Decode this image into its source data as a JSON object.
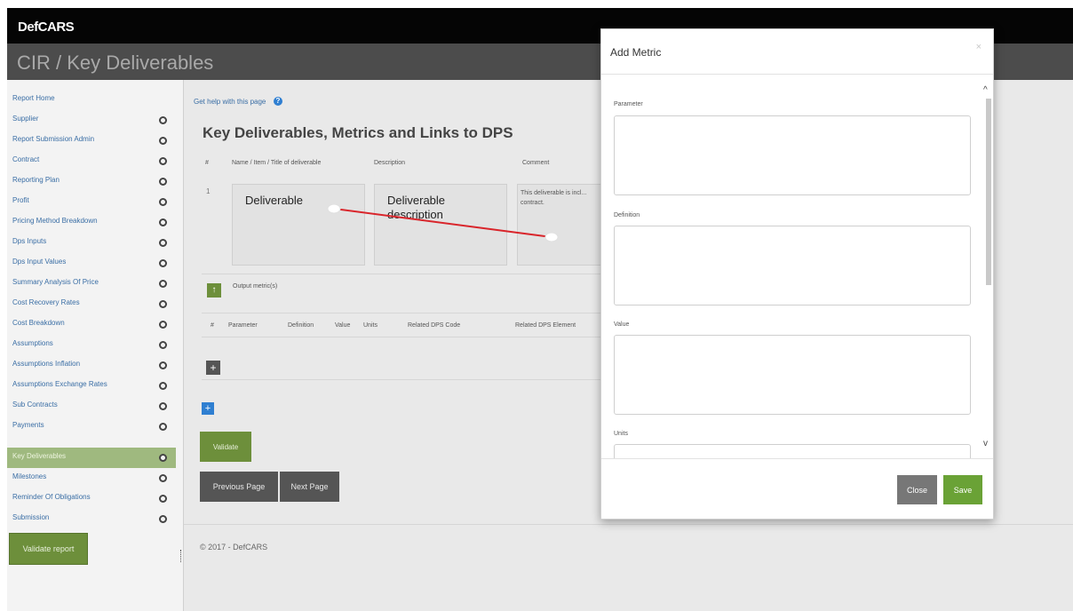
{
  "app": {
    "brand": "DefCARS",
    "page_title": "CIR / Key Deliverables"
  },
  "sidebar": {
    "items": [
      {
        "label": "Report Home",
        "dot": false
      },
      {
        "label": "Supplier",
        "dot": true
      },
      {
        "label": "Report Submission Admin",
        "dot": true
      },
      {
        "label": "Contract",
        "dot": true
      },
      {
        "label": "Reporting Plan",
        "dot": true
      },
      {
        "label": "Profit",
        "dot": true
      },
      {
        "label": "Pricing Method Breakdown",
        "dot": true
      },
      {
        "label": "Dps Inputs",
        "dot": true
      },
      {
        "label": "Dps Input Values",
        "dot": true
      },
      {
        "label": "Summary Analysis Of Price",
        "dot": true
      },
      {
        "label": "Cost Recovery Rates",
        "dot": true
      },
      {
        "label": "Cost Breakdown",
        "dot": true
      },
      {
        "label": "Assumptions",
        "dot": true
      },
      {
        "label": "Assumptions Inflation",
        "dot": true
      },
      {
        "label": "Assumptions Exchange Rates",
        "dot": true
      },
      {
        "label": "Sub Contracts",
        "dot": true
      },
      {
        "label": "Payments",
        "dot": true
      },
      {
        "label": "Key Deliverables",
        "dot": true,
        "active": true
      },
      {
        "label": "Milestones",
        "dot": true
      },
      {
        "label": "Reminder Of Obligations",
        "dot": true
      },
      {
        "label": "Submission",
        "dot": true
      }
    ],
    "validate_label": "Validate report"
  },
  "main": {
    "help_link": "Get help with this page",
    "heading": "Key Deliverables, Metrics and Links to DPS",
    "table_headers": [
      "#",
      "Name / Item / Title of deliverable",
      "Description",
      "Comment"
    ],
    "row": {
      "number": "1",
      "name": "Deliverable",
      "description": "Deliverable description",
      "comment": "This deliverable is incl... contract."
    },
    "output_metrics_label": "Output metric(s)",
    "metric_headers": [
      "#",
      "Parameter",
      "Definition",
      "Value",
      "Units",
      "Related DPS Code",
      "Related DPS Element"
    ],
    "validate_label": "Validate",
    "prev_label": "Previous Page",
    "next_label": "Next Page",
    "footer": "© 2017 - DefCARS",
    "connector_color": "#d9252b"
  },
  "modal": {
    "title": "Add Metric",
    "close_icon": "×",
    "fields": [
      "Parameter",
      "Definition",
      "Value",
      "Units"
    ],
    "close_label": "Close",
    "save_label": "Save"
  }
}
